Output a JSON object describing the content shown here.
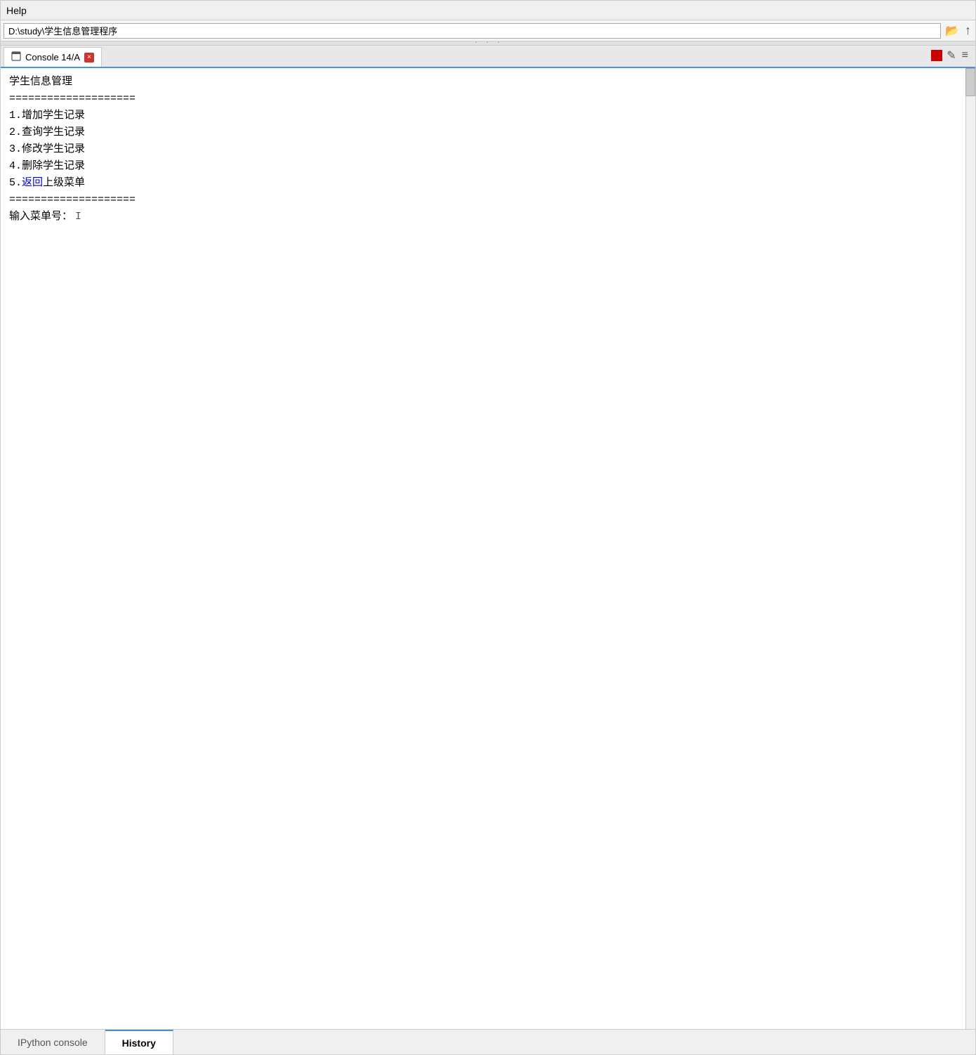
{
  "menubar": {
    "title": "Help"
  },
  "pathbar": {
    "value": "D:\\study\\学生信息管理程序",
    "folder_icon": "📁",
    "up_icon": "↑"
  },
  "tabs": {
    "active_tab": {
      "icon": "📄",
      "label": "Console 14/A",
      "close_icon": "×"
    },
    "actions": {
      "stop_color": "#cc0000",
      "edit_icon": "✎",
      "menu_icon": "≡"
    }
  },
  "console": {
    "lines": [
      {
        "text": "学生信息管理",
        "color": "normal"
      },
      {
        "text": "====================",
        "color": "normal"
      },
      {
        "text": "1.增加学生记录",
        "color": "normal"
      },
      {
        "text": "2.查询学生记录",
        "color": "normal"
      },
      {
        "text": "3.修改学生记录",
        "color": "normal"
      },
      {
        "text": "4.删除学生记录",
        "color": "normal"
      },
      {
        "text": "5.返回上级菜单",
        "color": "blue"
      },
      {
        "text": "====================",
        "color": "normal"
      },
      {
        "text": "",
        "color": "normal"
      },
      {
        "text": "输入菜单号：",
        "color": "normal",
        "has_cursor": true
      }
    ]
  },
  "bottom_tabs": [
    {
      "label": "IPython console",
      "active": false
    },
    {
      "label": "History",
      "active": false
    }
  ]
}
